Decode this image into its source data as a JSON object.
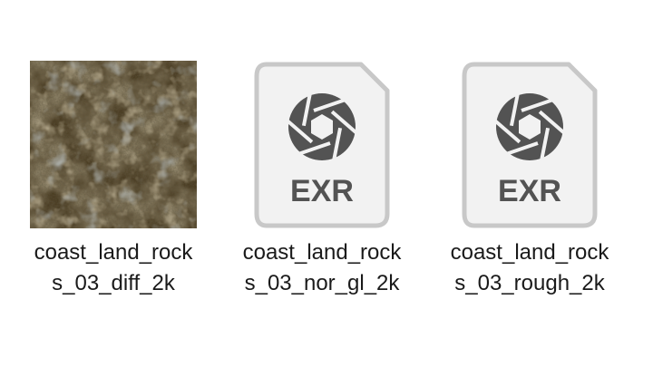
{
  "files": [
    {
      "name_line1": "coast_land_rock",
      "name_line2": "s_03_diff_2k",
      "icon": "image-thumbnail"
    },
    {
      "name_line1": "coast_land_rock",
      "name_line2": "s_03_nor_gl_2k",
      "icon": "exr-file-icon",
      "badge": "EXR"
    },
    {
      "name_line1": "coast_land_rock",
      "name_line2": "s_03_rough_2k",
      "icon": "exr-file-icon",
      "badge": "EXR"
    }
  ],
  "colors": {
    "icon_gray": "#535353",
    "icon_border": "#c8c8c8",
    "icon_fill": "#f2f2f2",
    "texture_base": "#5e4f33"
  }
}
